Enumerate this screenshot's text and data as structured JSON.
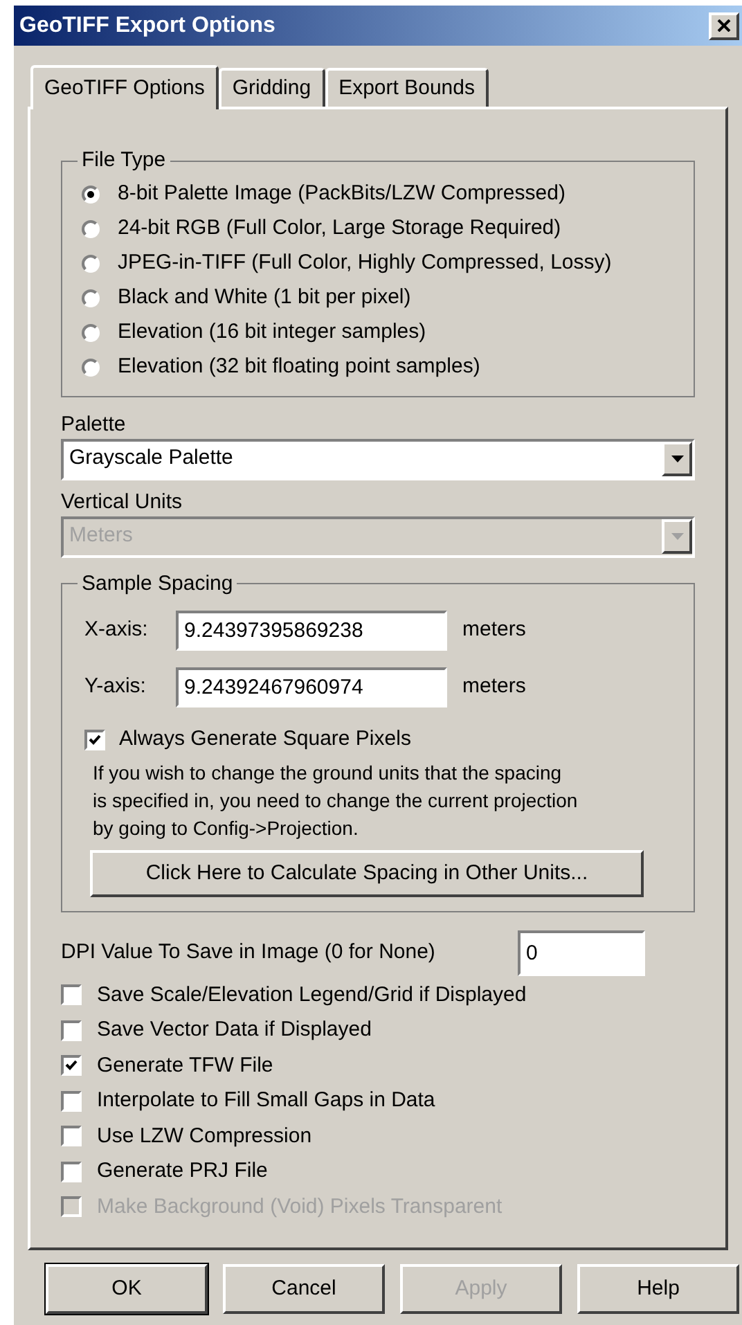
{
  "window": {
    "title": "GeoTIFF Export Options"
  },
  "tabs": [
    {
      "label": "GeoTIFF Options",
      "selected": true
    },
    {
      "label": "Gridding",
      "selected": false
    },
    {
      "label": "Export Bounds",
      "selected": false
    }
  ],
  "file_type": {
    "title": "File Type",
    "options": [
      {
        "label": "8-bit Palette Image (PackBits/LZW Compressed)",
        "selected": true
      },
      {
        "label": "24-bit RGB (Full Color, Large Storage Required)",
        "selected": false
      },
      {
        "label": "JPEG-in-TIFF (Full Color, Highly Compressed, Lossy)",
        "selected": false
      },
      {
        "label": "Black and White (1 bit per pixel)",
        "selected": false
      },
      {
        "label": "Elevation (16 bit integer samples)",
        "selected": false
      },
      {
        "label": "Elevation (32 bit floating point samples)",
        "selected": false
      }
    ]
  },
  "dropdowns": [
    {
      "label": "Palette",
      "value": "Grayscale Palette",
      "disabled": false
    },
    {
      "label": "Vertical Units",
      "value": "Meters",
      "disabled": true
    }
  ],
  "sample_spacing": {
    "title": "Sample Spacing",
    "axes": [
      {
        "label": "X-axis:",
        "value": "9.24397395869238",
        "unit": "meters"
      },
      {
        "label": "Y-axis:",
        "value": "9.24392467960974",
        "unit": "meters"
      }
    ],
    "square_pixels": {
      "label": "Always Generate Square Pixels",
      "checked": true
    },
    "note": "If you wish to change the ground units that the spacing is specified in, you need to change the current projection by going to Config->Projection.",
    "button": "Click Here to Calculate Spacing in Other Units..."
  },
  "dpi": {
    "label": "DPI Value To Save in Image (0 for None)",
    "value": "0"
  },
  "options": [
    {
      "label": "Save Scale/Elevation Legend/Grid if Displayed",
      "checked": false,
      "disabled": false
    },
    {
      "label": "Save Vector Data if Displayed",
      "checked": false,
      "disabled": false
    },
    {
      "label": "Generate TFW File",
      "checked": true,
      "disabled": false
    },
    {
      "label": "Interpolate to Fill Small Gaps in Data",
      "checked": false,
      "disabled": false
    },
    {
      "label": "Use LZW Compression",
      "checked": false,
      "disabled": false
    },
    {
      "label": "Generate PRJ File",
      "checked": false,
      "disabled": false
    },
    {
      "label": "Make Background (Void) Pixels Transparent",
      "checked": false,
      "disabled": true
    }
  ],
  "buttons": [
    {
      "label": "OK",
      "default": true,
      "disabled": false
    },
    {
      "label": "Cancel",
      "default": false,
      "disabled": false
    },
    {
      "label": "Apply",
      "default": false,
      "disabled": true
    },
    {
      "label": "Help",
      "default": false,
      "disabled": false
    }
  ]
}
